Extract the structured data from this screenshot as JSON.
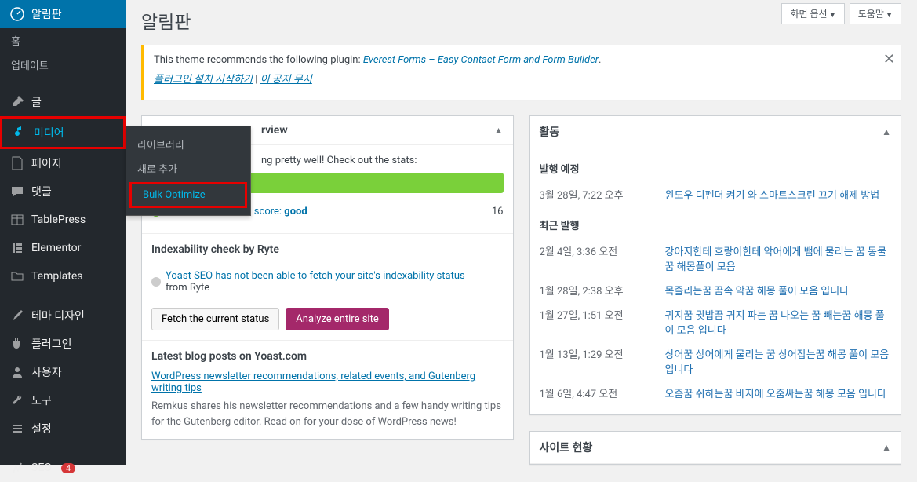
{
  "topbar": {
    "screen_options": "화면 옵션",
    "help": "도움말"
  },
  "page_title": "알림판",
  "sidebar": {
    "dashboard": "알림판",
    "home": "홈",
    "updates": "업데이트",
    "posts": "글",
    "media": "미디어",
    "pages": "페이지",
    "comments": "댓글",
    "tablepress": "TablePress",
    "elementor": "Elementor",
    "templates": "Templates",
    "theme": "테마 디자인",
    "plugins": "플러그인",
    "users": "사용자",
    "tools": "도구",
    "settings": "설정",
    "seo": "SEO",
    "seo_badge": "4"
  },
  "media_submenu": {
    "library": "라이브러리",
    "add_new": "새로 추가",
    "bulk_optimize": "Bulk Optimize"
  },
  "notice": {
    "text": "This theme recommends the following plugin: ",
    "plugin_link": "Everest Forms – Easy Contact Form and Form Builder",
    "period": ".",
    "install_link": "플러그인 설치 시작하기",
    "sep": " | ",
    "dismiss_link": "이 공지 무시"
  },
  "yoast": {
    "header_partial": "rview",
    "stats_text_partial": "ng pretty well! Check out the stats:",
    "posts_seo": "Posts with the SEO score: ",
    "good": "good",
    "good_count": "16",
    "index_title": "Indexability check by Ryte",
    "index_text1": "Yoast SEO has not been able to fetch your site's indexability status",
    "index_text2": "from Ryte",
    "btn_fetch": "Fetch the current status",
    "btn_analyze": "Analyze entire site",
    "blog_title": "Latest blog posts on Yoast.com",
    "blog_link": "WordPress newsletter recommendations, related events, and Gutenberg writing tips",
    "blog_desc": "Remkus shares his newsletter recommendations and a few handy writing tips for the Gutenberg editor. Read on for your dose of WordPress news!"
  },
  "activity": {
    "header": "활동",
    "scheduled_title": "발행 예정",
    "recent_title": "최근 발행",
    "site_status": "사이트 현황",
    "items": [
      {
        "time": "3월 28일, 7:22 오후",
        "title": "윈도우 디펜더 켜기 와 스마트스크린 끄기 해제 방법"
      },
      {
        "time": "2월 4일, 3:36 오전",
        "title": "강아지한테 호랑이한테 악어에게 뱀에 물리는 꿈 동물꿈 해몽풀이 모음"
      },
      {
        "time": "1월 28일, 2:38 오후",
        "title": "목졸리는꿈 꿈속 악꿈 해몽 풀이 모음 입니다"
      },
      {
        "time": "1월 27일, 1:51 오전",
        "title": "귀지꿈 귓밥꿈 귀지 파는 꿈 나오는 꿈 빼는꿈 해몽 풀이 모음 입니다"
      },
      {
        "time": "1월 13일, 1:29 오전",
        "title": "상어꿈 상어에게 물리는 꿈 상어잡는꿈 해몽 풀이 모음 입니다"
      },
      {
        "time": "1월 6일, 4:47 오전",
        "title": "오줌꿈 쉬하는꿈 바지에 오줌싸는꿈 해몽 모음 입니다"
      }
    ]
  }
}
